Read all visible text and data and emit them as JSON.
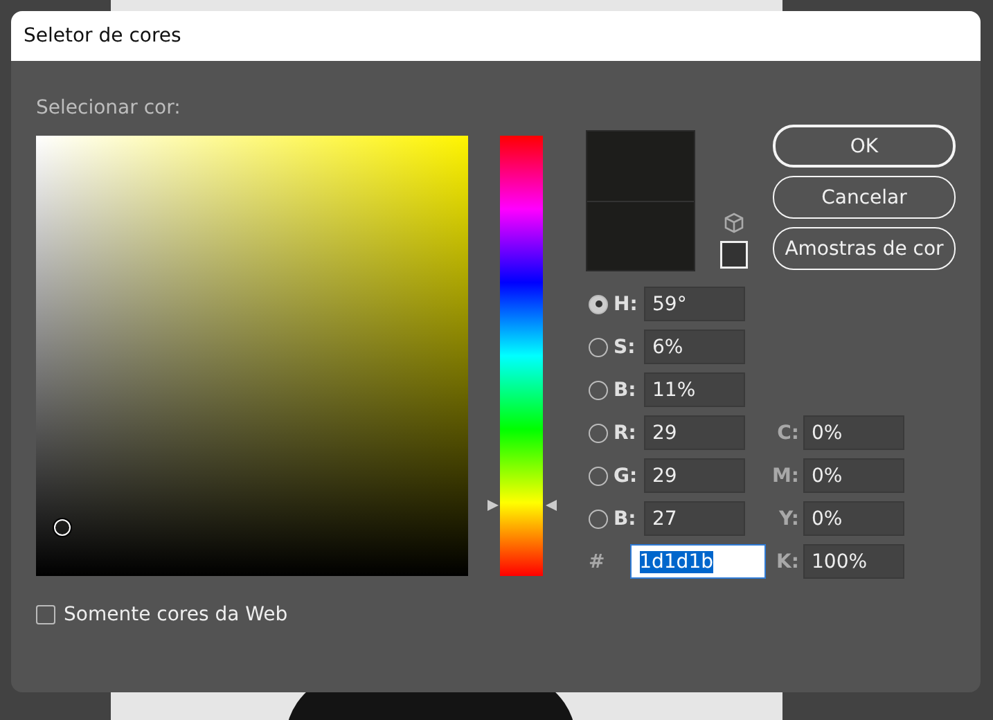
{
  "window": {
    "title": "Seletor de cores"
  },
  "prompt": "Selecionar cor:",
  "color_field": {
    "saturation": {
      "level": 0.06
    },
    "brightness": {
      "level": 0.11
    }
  },
  "hue_slider": {
    "level": 0.16
  },
  "preview": [
    {
      "color": "#1d1d1b"
    },
    {
      "color": "#1d1d1b"
    }
  ],
  "buttons": [
    {
      "label": "OK",
      "default": true
    },
    {
      "label": "Cancelar",
      "default": false
    },
    {
      "label": "Amostras de cor",
      "default": false
    }
  ],
  "hsb_rgb": [
    {
      "label": "H:",
      "value": "59°",
      "selected": true
    },
    {
      "label": "S:",
      "value": "6%",
      "selected": false
    },
    {
      "label": "B:",
      "value": "11%",
      "selected": false
    },
    {
      "label": "R:",
      "value": "29",
      "selected": false
    },
    {
      "label": "G:",
      "value": "29",
      "selected": false
    },
    {
      "label": "B:",
      "value": "27",
      "selected": false
    }
  ],
  "cmyk": [
    {
      "label": "C:",
      "value": "0%"
    },
    {
      "label": "M:",
      "value": "0%"
    },
    {
      "label": "Y:",
      "value": "0%"
    },
    {
      "label": "K:",
      "value": "100%"
    }
  ],
  "hex": {
    "label": "#",
    "value": "1d1d1b",
    "focused": true
  },
  "web_only": {
    "label": "Somente cores da Web",
    "checked": false
  }
}
